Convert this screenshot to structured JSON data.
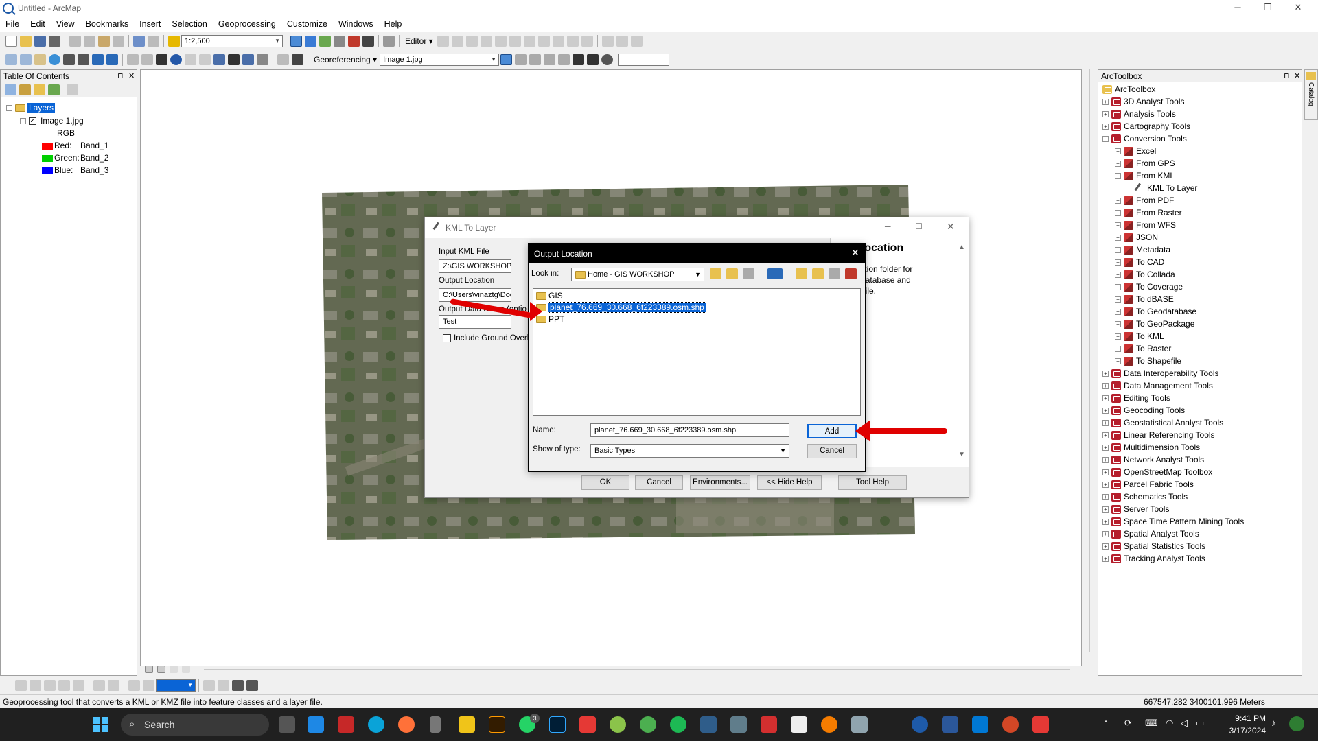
{
  "window": {
    "title": "Untitled - ArcMap"
  },
  "menu": [
    "File",
    "Edit",
    "View",
    "Bookmarks",
    "Insert",
    "Selection",
    "Geoprocessing",
    "Customize",
    "Windows",
    "Help"
  ],
  "toolbar": {
    "scale": "1:2,500",
    "editor_label": "Editor ▾",
    "georef_label": "Georeferencing ▾",
    "georef_layer": "Image 1.jpg"
  },
  "toc": {
    "title": "Table Of Contents",
    "layers_label": "Layers",
    "layer_name": "Image 1.jpg",
    "rgb_label": "RGB",
    "bands": [
      {
        "label": "Red:",
        "band": "Band_1",
        "color": "#ff0000"
      },
      {
        "label": "Green:",
        "band": "Band_2",
        "color": "#00d000"
      },
      {
        "label": "Blue:",
        "band": "Band_3",
        "color": "#0000ff"
      }
    ]
  },
  "arctoolbox": {
    "title": "ArcToolbox",
    "root": "ArcToolbox",
    "catalog_tab": "Catalog",
    "items": [
      {
        "label": "3D Analyst Tools",
        "level": 0
      },
      {
        "label": "Analysis Tools",
        "level": 0
      },
      {
        "label": "Cartography Tools",
        "level": 0
      },
      {
        "label": "Conversion Tools",
        "level": 0,
        "open": true
      },
      {
        "label": "Excel",
        "level": 1
      },
      {
        "label": "From GPS",
        "level": 1
      },
      {
        "label": "From KML",
        "level": 1,
        "open": true
      },
      {
        "label": "KML To Layer",
        "level": 2
      },
      {
        "label": "From PDF",
        "level": 1
      },
      {
        "label": "From Raster",
        "level": 1
      },
      {
        "label": "From WFS",
        "level": 1
      },
      {
        "label": "JSON",
        "level": 1
      },
      {
        "label": "Metadata",
        "level": 1
      },
      {
        "label": "To CAD",
        "level": 1
      },
      {
        "label": "To Collada",
        "level": 1
      },
      {
        "label": "To Coverage",
        "level": 1
      },
      {
        "label": "To dBASE",
        "level": 1
      },
      {
        "label": "To Geodatabase",
        "level": 1
      },
      {
        "label": "To GeoPackage",
        "level": 1
      },
      {
        "label": "To KML",
        "level": 1
      },
      {
        "label": "To Raster",
        "level": 1
      },
      {
        "label": "To Shapefile",
        "level": 1
      },
      {
        "label": "Data Interoperability Tools",
        "level": 0
      },
      {
        "label": "Data Management Tools",
        "level": 0
      },
      {
        "label": "Editing Tools",
        "level": 0
      },
      {
        "label": "Geocoding Tools",
        "level": 0
      },
      {
        "label": "Geostatistical Analyst Tools",
        "level": 0
      },
      {
        "label": "Linear Referencing Tools",
        "level": 0
      },
      {
        "label": "Multidimension Tools",
        "level": 0
      },
      {
        "label": "Network Analyst Tools",
        "level": 0
      },
      {
        "label": "OpenStreetMap Toolbox",
        "level": 0
      },
      {
        "label": "Parcel Fabric Tools",
        "level": 0
      },
      {
        "label": "Schematics Tools",
        "level": 0
      },
      {
        "label": "Server Tools",
        "level": 0
      },
      {
        "label": "Space Time Pattern Mining Tools",
        "level": 0
      },
      {
        "label": "Spatial Analyst Tools",
        "level": 0
      },
      {
        "label": "Spatial Statistics Tools",
        "level": 0
      },
      {
        "label": "Tracking Analyst Tools",
        "level": 0
      }
    ]
  },
  "kml_dialog": {
    "title": "KML To Layer",
    "input_label": "Input KML File",
    "input_value": "Z:\\GIS WORKSHOP\\Test.k",
    "output_label": "Output Location",
    "output_value": "C:\\Users\\vinaztg\\Docum",
    "dataname_label": "Output Data Name (optio",
    "dataname_value": "Test",
    "ground_overlay_label": "Include Ground Overlay",
    "help_title": "ut Location",
    "help_text_1": "stination folder for",
    "help_text_2": "geodatabase and",
    "help_text_3": ".lyr) file.",
    "buttons": {
      "ok": "OK",
      "cancel": "Cancel",
      "env": "Environments...",
      "hide_help": "<< Hide Help",
      "tool_help": "Tool Help"
    }
  },
  "output_dialog": {
    "title": "Output Location",
    "lookin_label": "Look in:",
    "lookin_value": "Home - GIS WORKSHOP",
    "files": [
      {
        "name": "GIS",
        "selected": false
      },
      {
        "name": "planet_76.669_30.668_6f223389.osm.shp",
        "selected": true
      },
      {
        "name": "PPT",
        "selected": false
      }
    ],
    "name_label": "Name:",
    "name_value": "planet_76.669_30.668_6f223389.osm.shp",
    "type_label": "Show of type:",
    "type_value": "Basic Types",
    "add_label": "Add",
    "cancel_label": "Cancel"
  },
  "status": {
    "message": "Geoprocessing tool that converts a KML or KMZ file into feature classes and a layer file.",
    "coords": "667547.282  3400101.996 Meters"
  },
  "taskbar": {
    "search_label": "Search",
    "time": "9:41 PM",
    "date": "3/17/2024",
    "whatsapp_badge": "3"
  }
}
